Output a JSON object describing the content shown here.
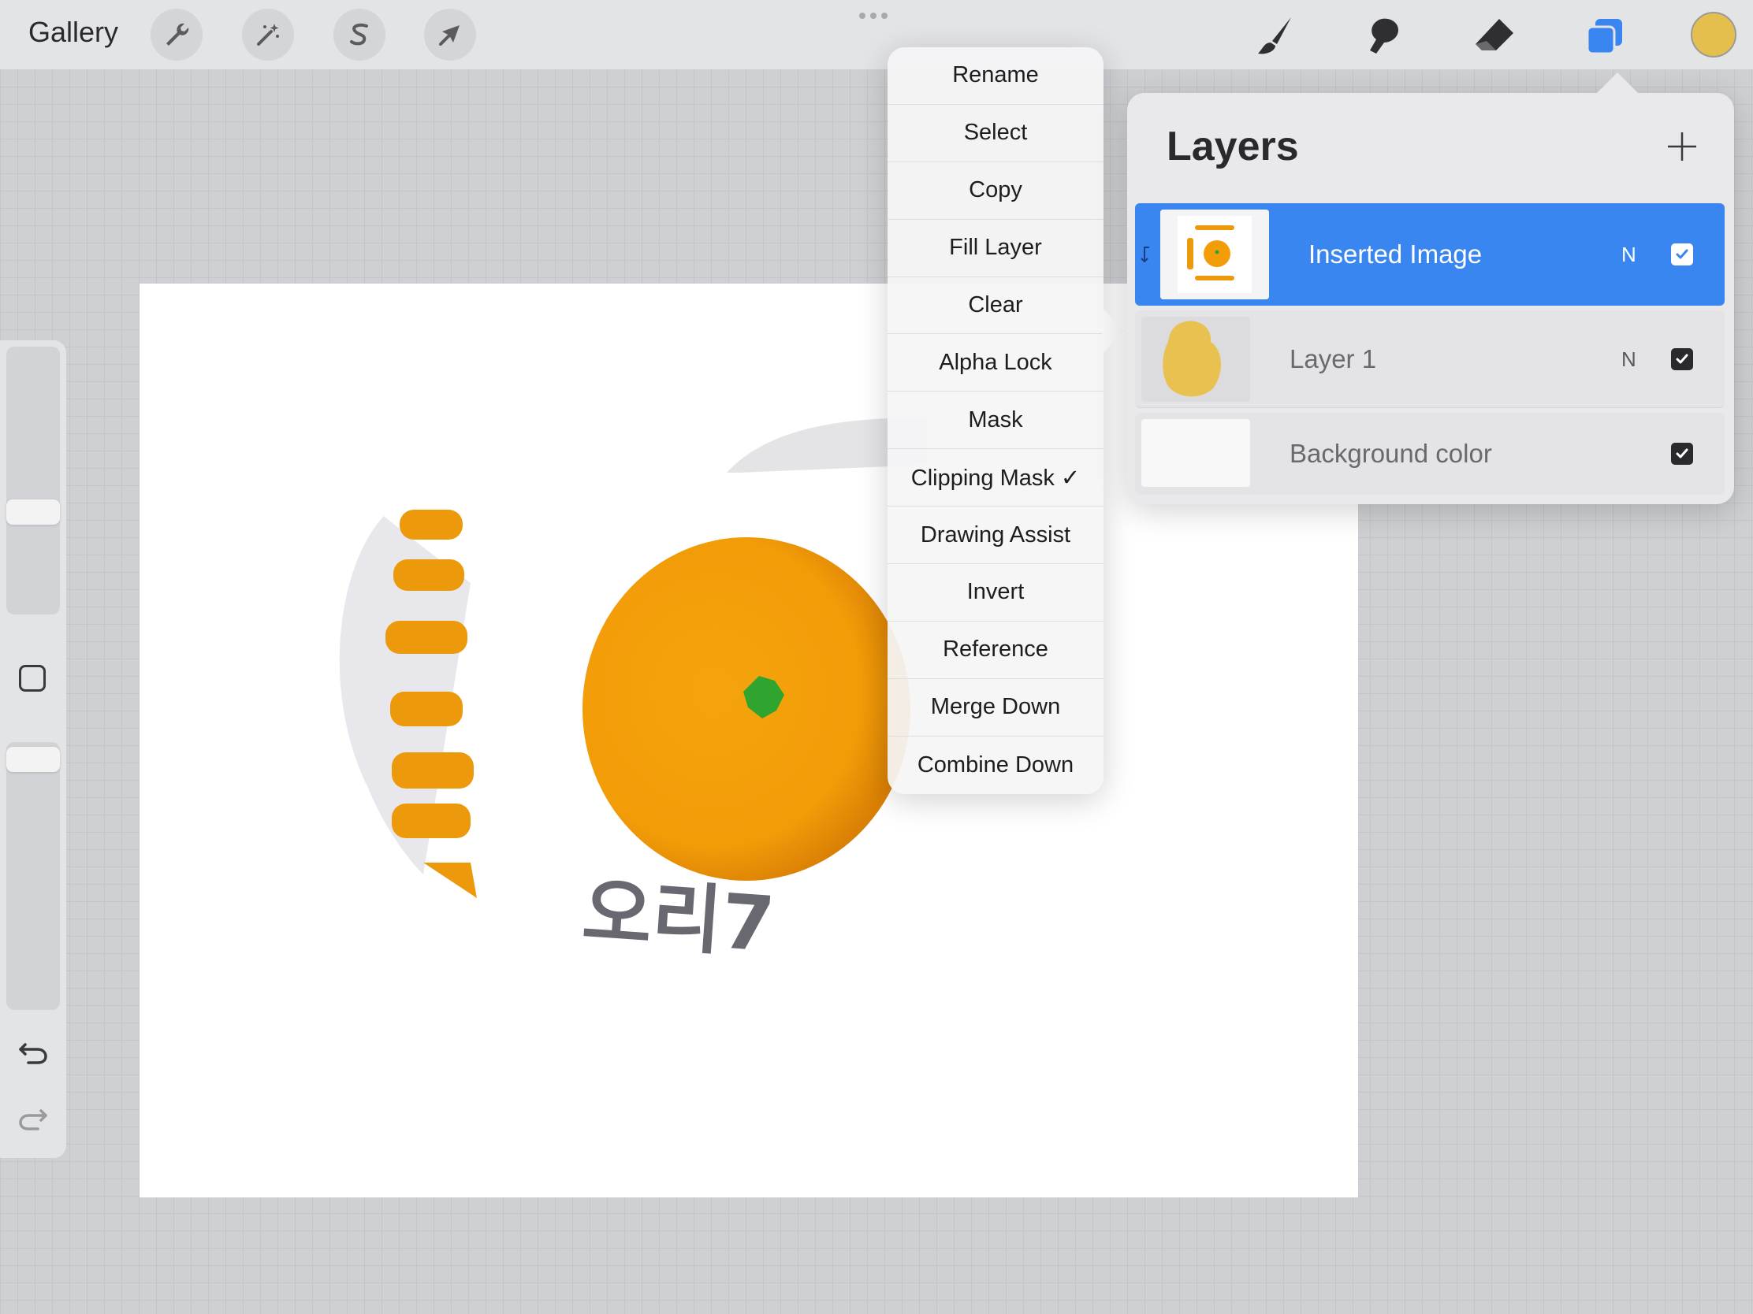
{
  "topbar": {
    "gallery_label": "Gallery",
    "left_tools": [
      "wrench-icon",
      "magic-wand-icon",
      "selection-s-icon",
      "transform-arrow-icon"
    ],
    "right_tools": [
      "brush-icon",
      "smudge-icon",
      "eraser-icon",
      "layers-icon"
    ],
    "current_color": "#e5bf4e"
  },
  "canvas": {
    "handwriting": "오리7"
  },
  "layer_actions_menu": {
    "items": [
      "Rename",
      "Select",
      "Copy",
      "Fill Layer",
      "Clear",
      "Alpha Lock",
      "Mask",
      "Clipping Mask ✓",
      "Drawing Assist",
      "Invert",
      "Reference",
      "Merge Down",
      "Combine Down"
    ]
  },
  "layers_panel": {
    "title": "Layers",
    "add_icon": "plus-icon",
    "layers": [
      {
        "name": "Inserted Image",
        "blend": "N",
        "visible": true,
        "selected": true,
        "clipped": true
      },
      {
        "name": "Layer 1",
        "blend": "N",
        "visible": true,
        "selected": false
      },
      {
        "name": "Background color",
        "blend": "",
        "visible": true,
        "selected": false
      }
    ]
  },
  "colors": {
    "accent": "#3a86f0",
    "orange": "#f2a20a",
    "layer1_fill": "#e8c150"
  }
}
